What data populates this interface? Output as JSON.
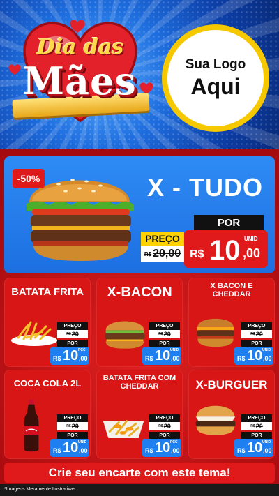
{
  "header": {
    "title_line1": "Dia das",
    "title_line2": "Mães",
    "logo_line1": "Sua Logo",
    "logo_line2": "Aqui"
  },
  "featured": {
    "badge": "-50%",
    "name": "X - TUDO",
    "preco_label": "PREÇO",
    "old_price_rs": "R$",
    "old_price": "20,00",
    "por_label": "POR",
    "unit": "UNID",
    "new_price_rs": "R$",
    "new_price_int": "10",
    "new_price_dec": ",00"
  },
  "products": [
    {
      "name": "BATATA FRITA",
      "preco_label": "PREÇO",
      "old_price_rs": "R$",
      "old_price": "20",
      "por_label": "POR",
      "unit": "PÇC",
      "rs": "R$",
      "int": "10",
      "dec": ",00"
    },
    {
      "name": "X-BACON",
      "preco_label": "PREÇO",
      "old_price_rs": "R$",
      "old_price": "20",
      "por_label": "POR",
      "unit": "UNID",
      "rs": "R$",
      "int": "10",
      "dec": ",00"
    },
    {
      "name": "X BACON E CHEDDAR",
      "preco_label": "PREÇO",
      "old_price_rs": "R$",
      "old_price": "20",
      "por_label": "POR",
      "unit": "UNID",
      "rs": "R$",
      "int": "10",
      "dec": ",00"
    },
    {
      "name": "COCA COLA 2L",
      "preco_label": "PREÇO",
      "old_price_rs": "R$",
      "old_price": "20",
      "por_label": "POR",
      "unit": "UNID",
      "rs": "R$",
      "int": "10",
      "dec": ",00"
    },
    {
      "name": "BATATA FRITA COM CHEDDAR",
      "preco_label": "PREÇO",
      "old_price_rs": "R$",
      "old_price": "20",
      "por_label": "POR",
      "unit": "PÇC",
      "rs": "R$",
      "int": "10",
      "dec": ",00"
    },
    {
      "name": "X-BURGUER",
      "preco_label": "PREÇO",
      "old_price_rs": "R$",
      "old_price": "20",
      "por_label": "POR",
      "unit": "UNID",
      "rs": "R$",
      "int": "10",
      "dec": ",00"
    }
  ],
  "footer": {
    "cta": "Crie seu encarte com este tema!",
    "disclaimer": "*Imagens Meramente Ilustrativas"
  },
  "colors": {
    "red": "#e01a1a",
    "blue": "#1d7ff0",
    "yellow": "#ffd200"
  }
}
